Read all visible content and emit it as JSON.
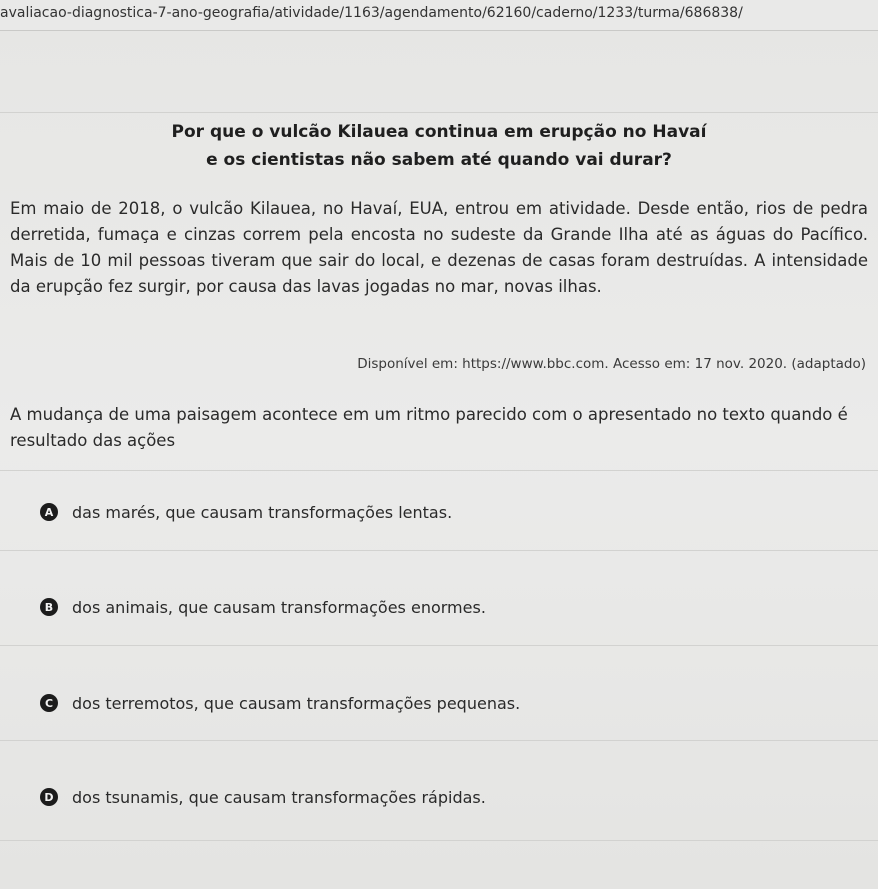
{
  "browser": {
    "url": "avaliacao-diagnostica-7-ano-geografia/atividade/1163/agendamento/62160/caderno/1233/turma/686838/"
  },
  "article": {
    "title_line1": "Por que o vulcão Kilauea continua em erupção no Havaí",
    "title_line2": "e os cientistas não sabem até quando vai durar?",
    "body": "Em maio de 2018, o vulcão Kilauea, no Havaí, EUA, entrou em atividade. Desde então, rios de pedra derretida, fumaça e cinzas correm pela encosta no sudeste da Grande Ilha até as águas do Pacífico. Mais de 10 mil pessoas tiveram que sair do local, e dezenas de casas foram destruídas. A intensidade da erupção fez surgir, por causa das lavas jogadas no mar, novas ilhas.",
    "source": "Disponível em: https://www.bbc.com. Acesso em: 17 nov. 2020. (adaptado)"
  },
  "question": {
    "text": "A mudança de uma paisagem acontece em um ritmo parecido com o apresentado no texto quando é resultado das ações"
  },
  "options": [
    {
      "letter": "A",
      "text": "das marés, que causam transformações lentas."
    },
    {
      "letter": "B",
      "text": "dos animais, que causam transformações enormes."
    },
    {
      "letter": "C",
      "text": "dos terremotos, que causam transformações pequenas."
    },
    {
      "letter": "D",
      "text": "dos tsunamis, que causam transformações rápidas."
    }
  ]
}
